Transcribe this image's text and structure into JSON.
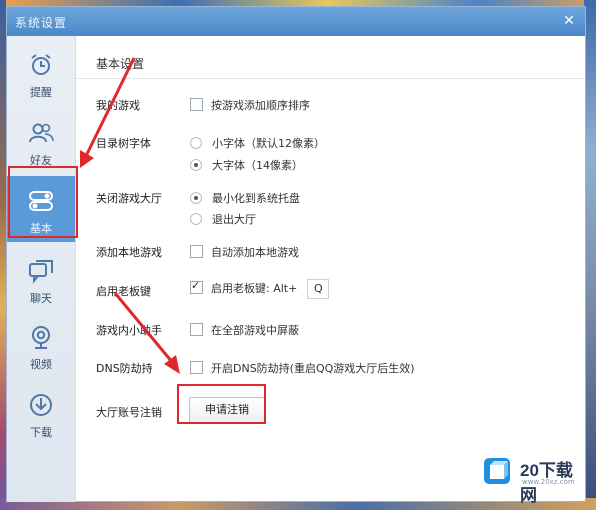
{
  "window": {
    "title": "系统设置",
    "close_glyph": "✕"
  },
  "sidebar": {
    "items": [
      {
        "label": "提醒",
        "icon": "alarm-clock-icon",
        "active": false
      },
      {
        "label": "好友",
        "icon": "friends-icon",
        "active": false
      },
      {
        "label": "基本",
        "icon": "toggle-settings-icon",
        "active": true
      },
      {
        "label": "聊天",
        "icon": "chat-windows-icon",
        "active": false
      },
      {
        "label": "视频",
        "icon": "webcam-icon",
        "active": false
      },
      {
        "label": "下载",
        "icon": "download-icon",
        "active": false
      }
    ]
  },
  "content": {
    "title": "基本设置",
    "rows": {
      "my_games": {
        "label": "我的游戏",
        "option": "按游戏添加顺序排序",
        "checked": false
      },
      "tree_font": {
        "label": "目录树字体",
        "options": [
          "小字体（默认12像素）",
          "大字体（14像素）"
        ],
        "selected": 1
      },
      "close_hall": {
        "label": "关闭游戏大厅",
        "options": [
          "最小化到系统托盘",
          "退出大厅"
        ],
        "selected": 0
      },
      "add_local": {
        "label": "添加本地游戏",
        "option": "自动添加本地游戏",
        "checked": false
      },
      "boss_key": {
        "label": "启用老板键",
        "option": "启用老板键: Alt+",
        "key": "Q",
        "checked": true
      },
      "ingame_helper": {
        "label": "游戏内小助手",
        "option": "在全部游戏中屏蔽",
        "checked": false
      },
      "dns": {
        "label": "DNS防劫持",
        "option": "开启DNS防劫持(重启QQ游戏大厅后生效)",
        "checked": false
      },
      "account_cancel": {
        "label": "大厅账号注销",
        "button": "申请注销"
      }
    }
  },
  "annotation": {
    "color": "#e0282a"
  },
  "watermark": {
    "text": "20下载网",
    "url": "www.20xz.com",
    "brand_color": "#2a3a58"
  }
}
